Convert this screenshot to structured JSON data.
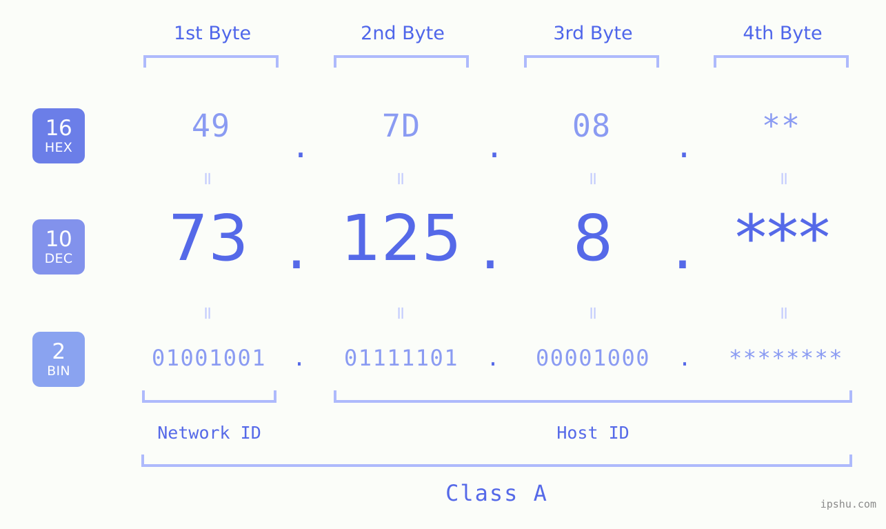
{
  "watermark": "ipshu.com",
  "byte_headers": [
    {
      "label": "1st Byte"
    },
    {
      "label": "2nd Byte"
    },
    {
      "label": "3rd Byte"
    },
    {
      "label": "4th Byte"
    }
  ],
  "bases": [
    {
      "id": "hex",
      "radix": "16",
      "name": "HEX",
      "color": "#6b7ee8"
    },
    {
      "id": "dec",
      "radix": "10",
      "name": "DEC",
      "color": "#8292ec"
    },
    {
      "id": "bin",
      "radix": "2",
      "name": "BIN",
      "color": "#8aa3f0"
    }
  ],
  "rows": {
    "hex": {
      "values": [
        "49",
        "7D",
        "08",
        "**"
      ],
      "separators": [
        ".",
        ".",
        "."
      ]
    },
    "dec": {
      "values": [
        "73",
        "125",
        "8",
        "***"
      ],
      "separators": [
        ".",
        ".",
        "."
      ]
    },
    "bin": {
      "values": [
        "01001001",
        "01111101",
        "00001000",
        "********"
      ],
      "separators": [
        ".",
        ".",
        "."
      ]
    }
  },
  "equals": {
    "glyph": "=",
    "hex_to_dec": [
      "=",
      "=",
      "=",
      "="
    ],
    "dec_to_bin": [
      "=",
      "=",
      "=",
      "="
    ]
  },
  "segments": {
    "network_id": "Network ID",
    "host_id": "Host ID",
    "class": "Class A"
  },
  "colors": {
    "background": "#fbfdf9",
    "accent_strong": "#5569e8",
    "accent_light": "#8a9bf2",
    "bracket": "#aebafc",
    "equals": "#c3ccfd",
    "watermark": "#8a8a8a"
  }
}
